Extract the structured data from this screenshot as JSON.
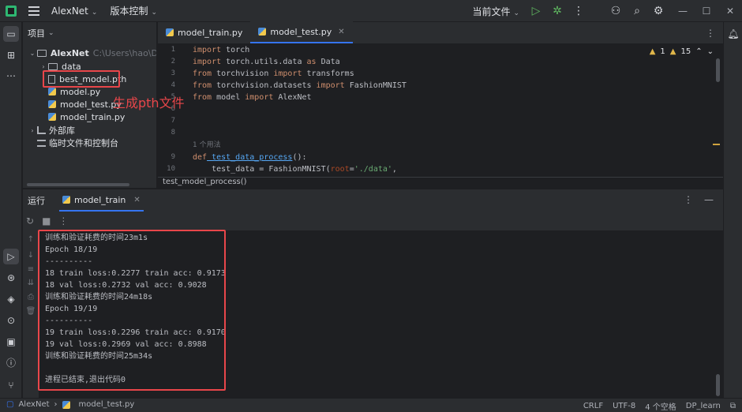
{
  "titlebar": {
    "project": "AlexNet",
    "vcs": "版本控制",
    "run_config": "当前文件"
  },
  "project_panel": {
    "title": "项目",
    "root": "AlexNet",
    "root_path": "C:\\Users\\hao\\Desktop",
    "items": [
      {
        "label": "data",
        "type": "folder"
      },
      {
        "label": "best_model.pth",
        "type": "file"
      },
      {
        "label": "model.py",
        "type": "python"
      },
      {
        "label": "model_test.py",
        "type": "python"
      },
      {
        "label": "model_train.py",
        "type": "python"
      }
    ],
    "external_libs": "外部库",
    "scratches": "临时文件和控制台"
  },
  "annotation": "生成pth文件",
  "editor": {
    "tabs": [
      {
        "label": "model_train.py"
      },
      {
        "label": "model_test.py"
      }
    ],
    "inspection": {
      "warnings": "1",
      "weak_warnings": "15"
    },
    "line_numbers": [
      "1",
      "2",
      "3",
      "4",
      "5",
      "6",
      "7",
      "8",
      "9",
      "10"
    ],
    "usages_hint": "1 个用法",
    "code": [
      {
        "kw": "import",
        "rest": " torch"
      },
      {
        "kw": "import",
        "rest": " torch.utils.data ",
        "kw2": "as",
        "rest2": " Data"
      },
      {
        "kw": "from",
        "rest": " torchvision ",
        "kw2": "import",
        "rest2": " transforms"
      },
      {
        "kw": "from",
        "rest": " torchvision.datasets ",
        "kw2": "import",
        "rest2": " FashionMNIST"
      },
      {
        "kw": "from",
        "rest": " model ",
        "kw2": "import",
        "rest2": " AlexNet"
      },
      {
        "kw": "def",
        "fn": " test_data_process",
        "rest": "():"
      },
      {
        "indent": "    ",
        "rest": "test_data = FashionMNIST(",
        "param": "root",
        "rest2": "=",
        "str": "'./data'",
        "rest3": ","
      }
    ],
    "breadcrumb": "test_model_process()"
  },
  "run_panel": {
    "title": "运行",
    "tab": "model_train",
    "output": [
      "训练和验证耗费的时间23m1s",
      "Epoch 18/19",
      "----------",
      "18 train loss:0.2277 train acc: 0.9173",
      "18 val loss:0.2732 val acc: 0.9028",
      "训练和验证耗费的时间24m18s",
      "Epoch 19/19",
      "----------",
      "19 train loss:0.2296 train acc: 0.9170",
      "19 val loss:0.2969 val acc: 0.8988",
      "训练和验证耗费的时间25m34s",
      "",
      "进程已结束,退出代码0"
    ]
  },
  "statusbar": {
    "project": "AlexNet",
    "file": "model_test.py",
    "line_sep": "CRLF",
    "encoding": "UTF-8",
    "indent": "4 个空格",
    "interpreter": "DP_learn"
  },
  "colors": {
    "accent": "#3574f0",
    "highlight": "#e8464a",
    "run_green": "#5fb760"
  }
}
